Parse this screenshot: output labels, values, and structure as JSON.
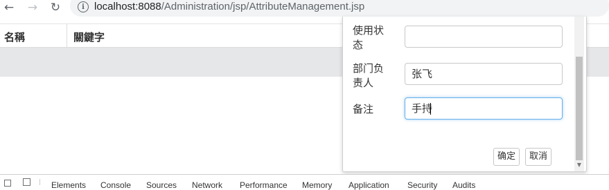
{
  "browser": {
    "url_host": "localhost:8088",
    "url_path": "/Administration/jsp/AttributeManagement.jsp",
    "back_icon": "arrow-left-icon",
    "forward_icon": "arrow-right-icon",
    "reload_icon": "reload-icon",
    "info_icon": "info-icon"
  },
  "table": {
    "columns": [
      "名稱",
      "關鍵字"
    ]
  },
  "dialog": {
    "fields": {
      "status": {
        "label": "使用状态",
        "value": ""
      },
      "head": {
        "label": "部门负责人",
        "value": "张飞"
      },
      "remark": {
        "label": "备注",
        "value": "手持"
      }
    },
    "confirm_label": "确定",
    "cancel_label": "取消"
  },
  "devtools": {
    "tabs": [
      "Elements",
      "Console",
      "Sources",
      "Network",
      "Performance",
      "Memory",
      "Application",
      "Security",
      "Audits"
    ]
  }
}
